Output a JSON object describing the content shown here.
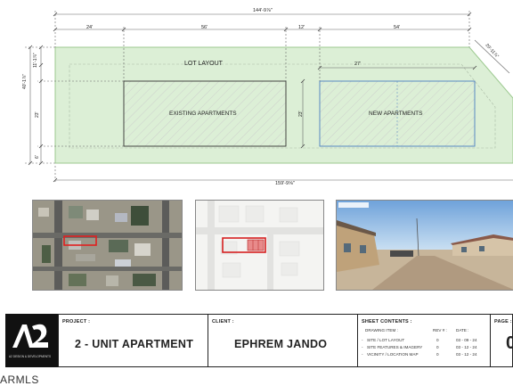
{
  "drawing": {
    "dimensions": {
      "overall_top": "144'-9⅞\"",
      "seg1": "24'",
      "seg2": "56'",
      "seg3": "12'",
      "seg4": "54'",
      "angled": "20'-11⅞\"",
      "left_upper": "11'-1⅞\"",
      "left_total": "40'-1⅞\"",
      "left_mid": "23'",
      "left_low": "6'",
      "building_height": "23'",
      "building_width": "27'",
      "overall_bottom": "159'-9⅝\""
    },
    "lot_label": "LOT LAYOUT",
    "existing_label": "EXISTING APARTMENTS",
    "new_label": "NEW APARTMENTS"
  },
  "thumbnails": {
    "satellite": "satellite-aerial-view",
    "map": "vicinity-location-map",
    "street": "street-view-photo"
  },
  "title_block": {
    "logo_text": "A2",
    "logo_caption": "A2 DESIGN & DEVELOPMENTS",
    "project_heading": "PROJECT :",
    "project_name": "2 - UNIT APARTMENT",
    "client_heading": "CLIENT :",
    "client_name": "EPHREM JANDO",
    "sheet_heading": "SHEET CONTENTS :",
    "col_item": "DRAWING ITEM :",
    "col_rev": "REV # :",
    "col_date": "DATE :",
    "rows": [
      {
        "item": "SITE / LOT LAYOUT",
        "rev": "0",
        "date": "03 - 09 - 24"
      },
      {
        "item": "SITE FEATURES & IMAGERY",
        "rev": "0",
        "date": "03 - 12 - 24"
      },
      {
        "item": "VICINITY / LOCATION MAP",
        "rev": "0",
        "date": "03 - 12 - 24"
      }
    ],
    "page_heading": "PAGE :",
    "page_number": "0"
  },
  "watermark": "ARMLS",
  "colors": {
    "lot_fill": "#dcefd6",
    "lot_stroke": "#9cc98f",
    "existing_stroke": "#333333",
    "new_stroke": "#4a7fc1",
    "dim_line": "#666666",
    "highlight": "#d62020"
  }
}
